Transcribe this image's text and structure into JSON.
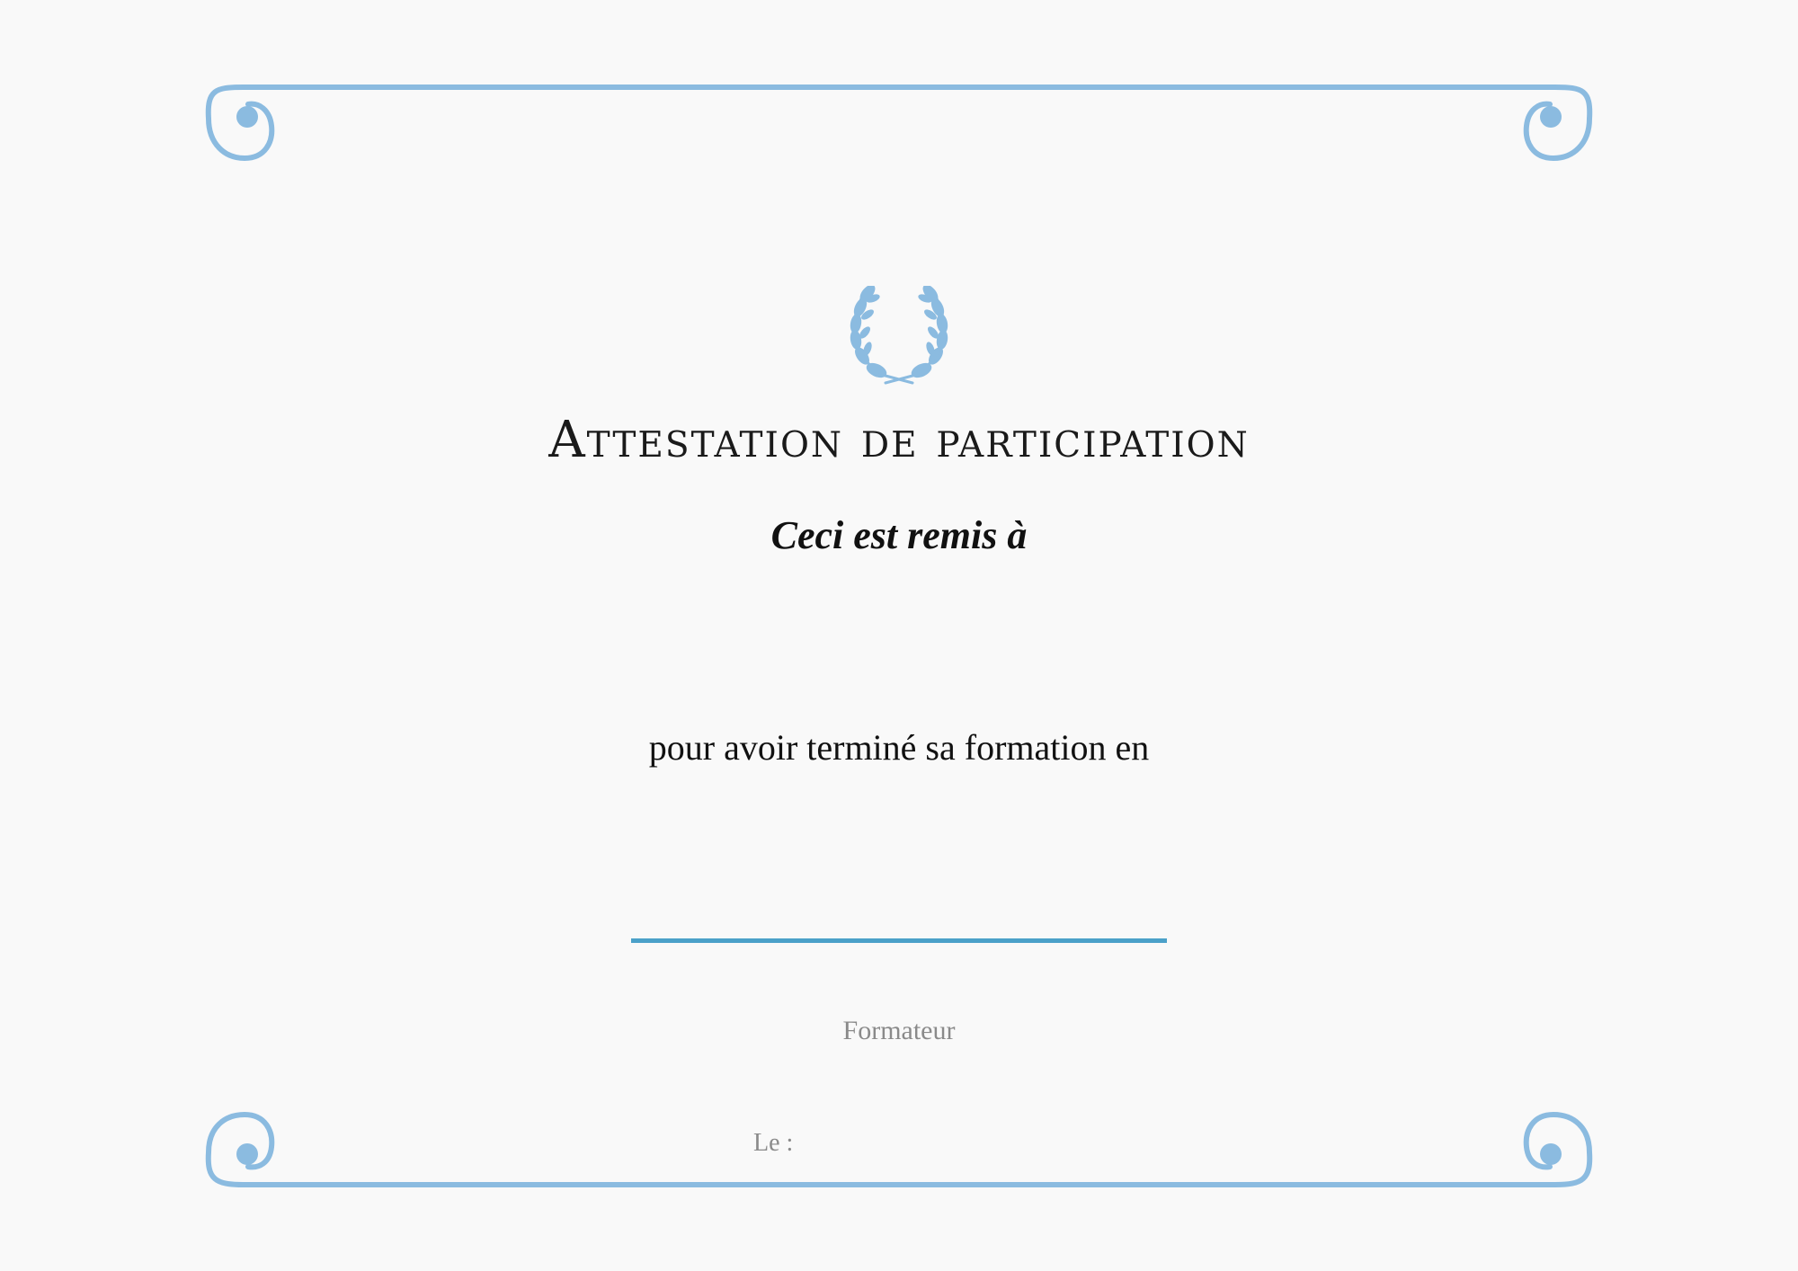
{
  "certificate": {
    "title": "Attestation de participation",
    "subtitle": "Ceci est remis à",
    "body": "pour avoir terminé sa formation en",
    "signature_role": "Formateur",
    "date_label": "Le :"
  },
  "colors": {
    "frame": "#8bbbe0",
    "laurel": "#8bbbe0",
    "signature_line": "#4ba1c9",
    "background": "#f9f9f9"
  },
  "icons": {
    "emblem": "laurel-wreath-icon"
  }
}
